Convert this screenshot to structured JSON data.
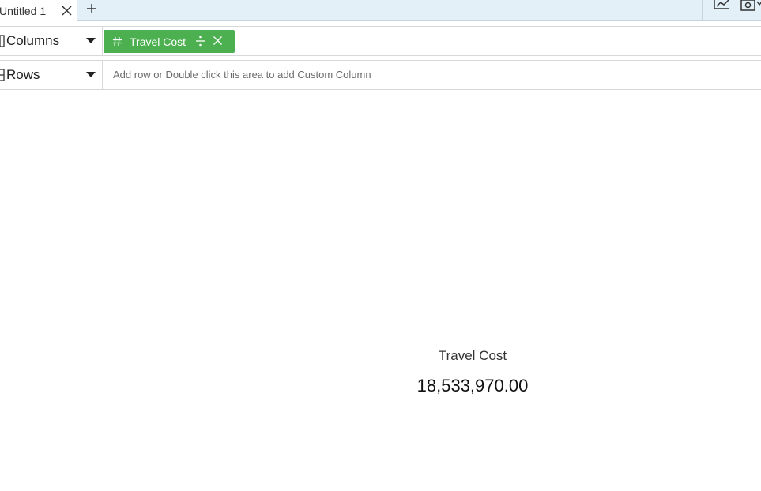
{
  "tabs": {
    "active": {
      "label": "Untitled 1"
    }
  },
  "icons": {
    "tab_close": "close-icon",
    "tab_add": "plus-icon",
    "toolbar_chart": "line-chart-icon",
    "toolbar_camera": "camera-icon",
    "shelf_dropdown": "caret-down-icon",
    "measure": "hash-icon",
    "pill_divide": "divide-icon",
    "pill_remove": "close-icon"
  },
  "shelves": {
    "columns": {
      "label": "Columns",
      "pills": [
        {
          "label": "Travel Cost"
        }
      ]
    },
    "rows": {
      "label": "Rows",
      "placeholder": "Add row or Double click this area to add Custom Column"
    }
  },
  "kpi": {
    "label": "Travel Cost",
    "value": "18,533,970.00"
  },
  "colors": {
    "tab_strip_bg": "#e3f0f8",
    "pill_bg": "#4caf50",
    "pill_text": "#ffffff"
  }
}
